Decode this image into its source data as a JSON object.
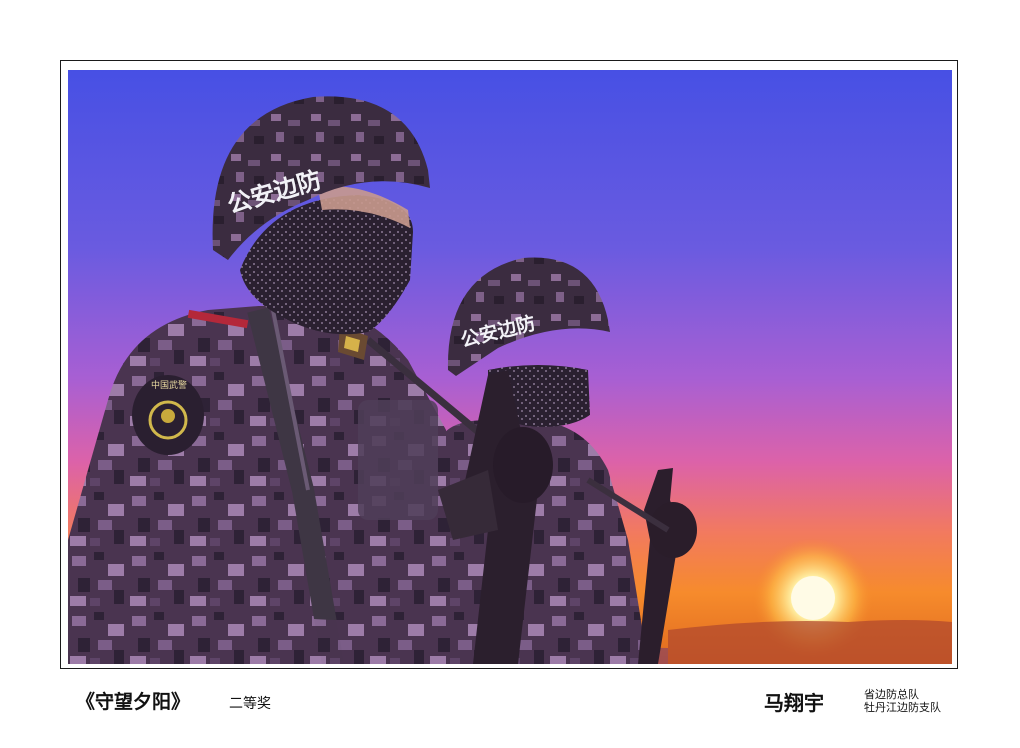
{
  "photo": {
    "helmet_text_front": "公安边防",
    "helmet_text_back": "公安边防",
    "shoulder_patch_text": "中国武警",
    "colors": {
      "sky_top": "#4a55e6",
      "sky_mid": "#a55ed2",
      "sky_pink": "#e063a8",
      "horizon_orange": "#f68a2e",
      "sun": "#fff6c0",
      "camo_dark": "#3a2a3e",
      "camo_light": "#9c7aa6"
    }
  },
  "caption": {
    "title": "《守望夕阳》",
    "award": "二等奖",
    "author": "马翔宇",
    "unit_line1": "省边防总队",
    "unit_line2": "牡丹江边防支队"
  }
}
